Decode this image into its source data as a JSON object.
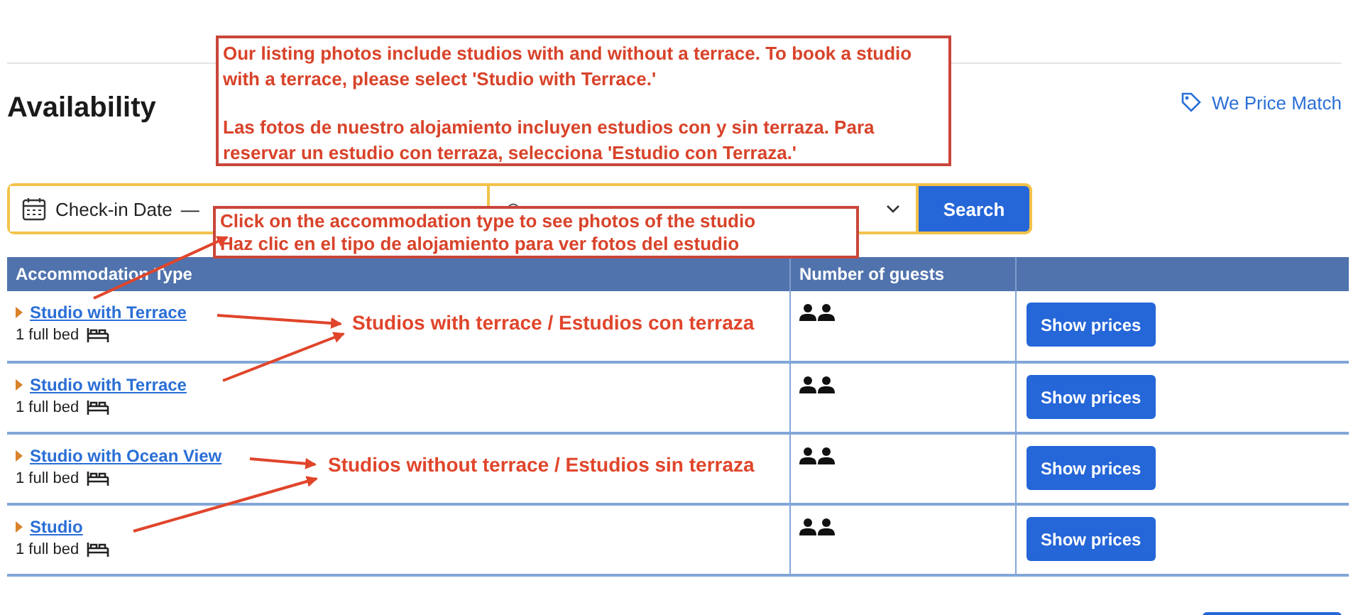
{
  "heading": "Availability",
  "price_match": {
    "label": "We Price Match"
  },
  "search_bar": {
    "date_field": {
      "start": "Check-in Date",
      "separator": "—"
    },
    "search_button": "Search"
  },
  "table": {
    "columns": [
      "Accommodation Type",
      "Number of guests"
    ],
    "rows": [
      {
        "name": "Studio with Terrace",
        "beds": "1 full bed",
        "button": "Show prices"
      },
      {
        "name": "Studio with Terrace",
        "beds": "1 full bed",
        "button": "Show prices"
      },
      {
        "name": "Studio with Ocean View",
        "beds": "1 full bed",
        "button": "Show prices"
      },
      {
        "name": "Studio",
        "beds": "1 full bed",
        "button": "Show prices"
      }
    ]
  },
  "annotations": {
    "notice": {
      "english": "Our listing photos include studios with and without a terrace. To book a studio with a terrace, please select 'Studio with Terrace.'",
      "spanish": "Las fotos de nuestro alojamiento incluyen estudios con y sin terraza. Para reservar un estudio con terraza, selecciona 'Estudio con Terraza.'"
    },
    "click_hint": [
      "Click on the accommodation type to see photos of the studio",
      "Haz clic en el tipo de alojamiento para ver fotos del estudio"
    ],
    "labels": [
      "Studios with terrace / Estudios con terraza",
      "Studios without terrace / Estudios sin terraza"
    ]
  }
}
